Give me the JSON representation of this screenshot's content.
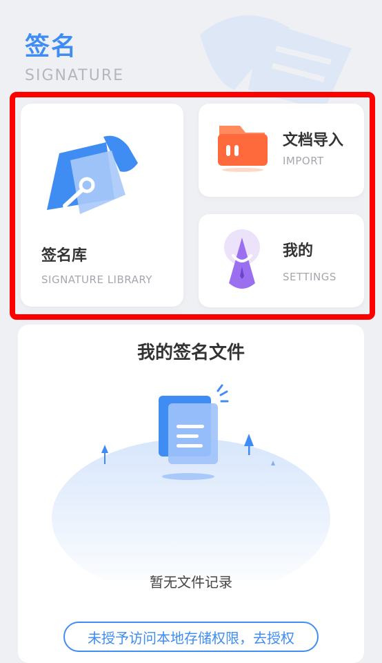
{
  "header": {
    "title": "签名",
    "subtitle": "SIGNATURE"
  },
  "cards": {
    "library": {
      "title": "签名库",
      "subtitle": "SIGNATURE LIBRARY"
    },
    "import": {
      "title": "文档导入",
      "subtitle": "IMPORT"
    },
    "mine": {
      "title": "我的",
      "subtitle": "SETTINGS"
    }
  },
  "files": {
    "title": "我的签名文件",
    "empty_text": "暂无文件记录",
    "auth_button": "未授予访问本地存储权限，去授权"
  },
  "colors": {
    "accent": "#3f8cf2",
    "highlight": "#ff0000",
    "import_orange": "#ff6a3d",
    "mine_purple": "#9a6ff0"
  }
}
